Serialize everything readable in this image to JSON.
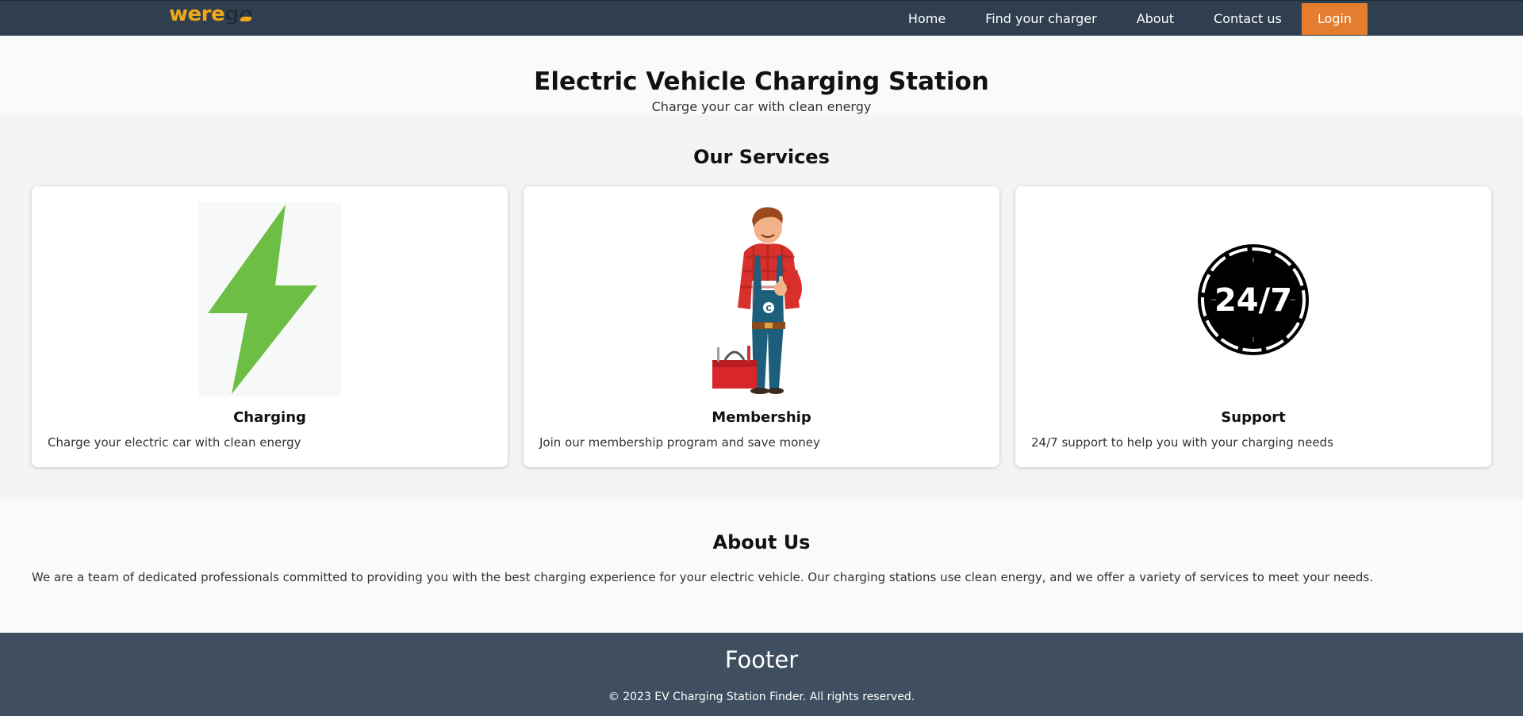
{
  "navbar": {
    "logo": {
      "part1": "were",
      "part2": "go"
    },
    "links": [
      "Home",
      "Find your charger",
      "About",
      "Contact us"
    ],
    "login_label": "Login"
  },
  "hero": {
    "title": "Electric Vehicle Charging Station",
    "subtitle": "Charge your car with clean energy"
  },
  "services": {
    "title": "Our Services",
    "cards": [
      {
        "icon": "lightning-bolt-icon",
        "title": "Charging",
        "text": "Charge your electric car with clean energy"
      },
      {
        "icon": "mechanic-illustration",
        "title": "Membership",
        "text": "Join our membership program and save money"
      },
      {
        "icon": "24-7-clock-icon",
        "title": "Support",
        "text": "24/7 support to help you with your charging needs",
        "badge_text": "24/7"
      }
    ]
  },
  "about": {
    "title": "About Us",
    "text": "We are a team of dedicated professionals committed to providing you with the best charging experience for your electric vehicle. Our charging stations use clean energy, and we offer a variety of services to meet your needs."
  },
  "footer": {
    "title": "Footer",
    "copyright": "© 2023 EV Charging Station Finder. All rights reserved."
  },
  "colors": {
    "navbar_bg": "#2f3f4f",
    "accent": "#e57d31",
    "footer_bg": "#3f4f5f",
    "bolt_green": "#6dbe45"
  }
}
